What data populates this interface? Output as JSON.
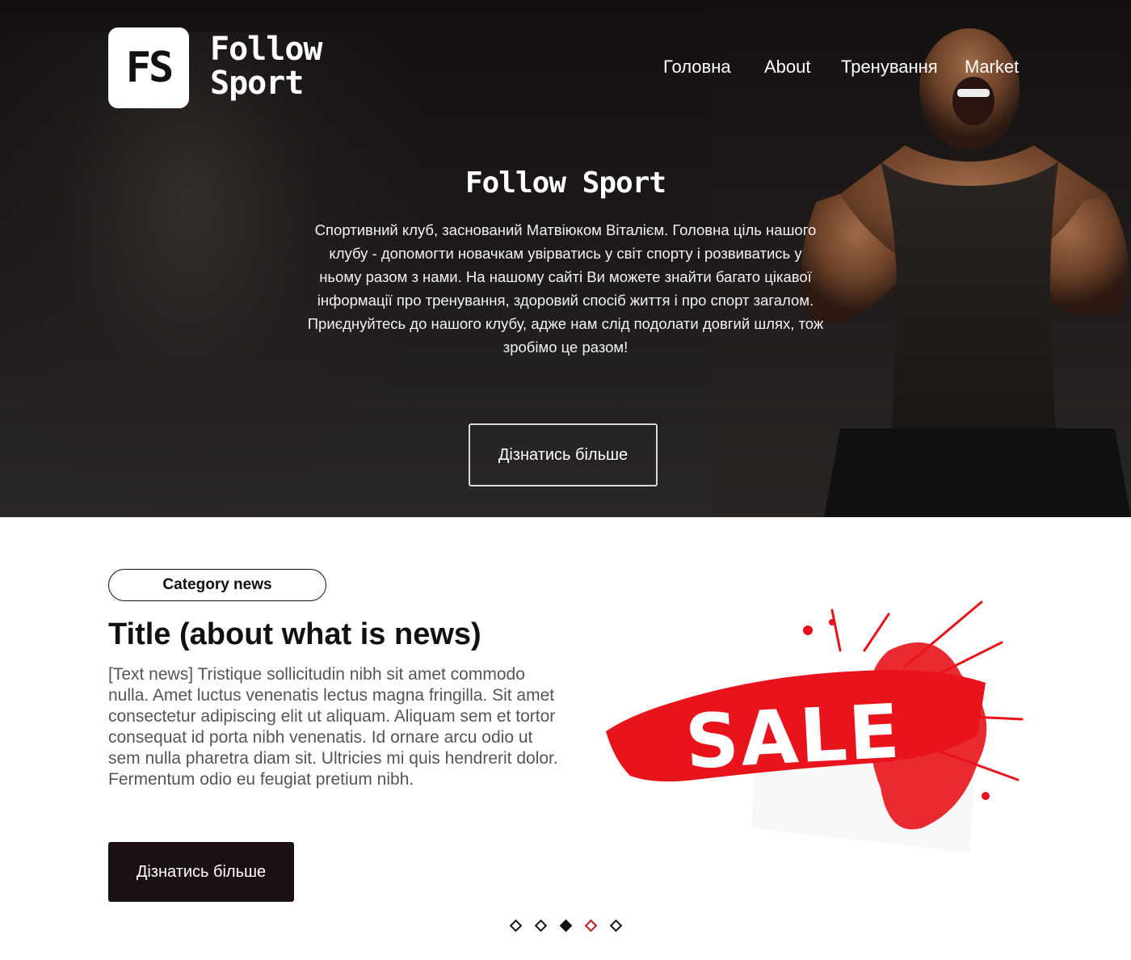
{
  "header": {
    "logo_mark": "FS",
    "logo_line1": "Follow",
    "logo_line2": "Sport",
    "nav": [
      "Головна",
      "About",
      "Тренування",
      "Market"
    ]
  },
  "hero": {
    "title": "Follow Sport",
    "description": "Спортивний клуб, заснований Матвіюком Віталієм. Головна ціль нашого клубу - допомогти новачкам увірватись у світ спорту і розвиватись у ньому разом з нами. На нашому сайті Ви можете знайти багато цікавої інформації про тренування, здоровий спосіб життя і про спорт загалом. Приєднуйтесь до нашого клубу, адже нам слід подолати довгий шлях, тож зробімо це разом!",
    "button": "Дізнатись більше"
  },
  "news": {
    "category": "Category news",
    "title": "Title (about what is news)",
    "text": "[Text news] Tristique sollicitudin nibh sit amet commodo nulla. Amet luctus venenatis lectus magna fringilla. Sit amet consectetur adipiscing elit ut aliquam. Aliquam sem et tortor consequat id porta nibh venenatis. Id ornare arcu odio ut sem nulla pharetra diam sit. Ultricies mi quis hendrerit dolor. Fermentum odio eu feugiat pretium nibh.",
    "button": "Дізнатись більше",
    "image_text": "SALE"
  },
  "slider": {
    "count": 5,
    "active_index": 2,
    "highlighted_index": 3
  },
  "colors": {
    "dark": "#1b1112",
    "sale_red": "#e8131b",
    "accent": "#c0171a"
  }
}
